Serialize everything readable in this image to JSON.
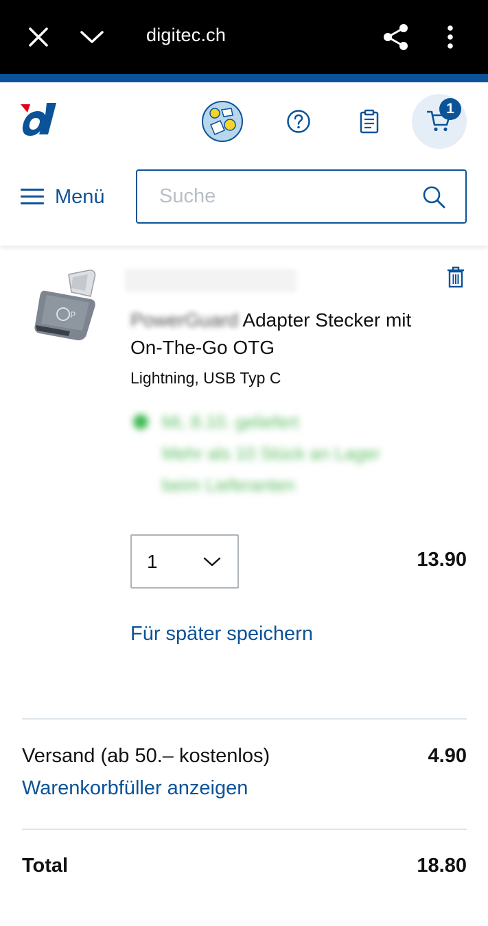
{
  "browser": {
    "url": "digitec.ch",
    "icons": [
      "close-icon",
      "chevron-down-icon",
      "share-icon",
      "more-vert-icon"
    ]
  },
  "header": {
    "logo": "digitec-logo",
    "cart_count": "1",
    "menu_label": "Menü",
    "search_placeholder": "Suche",
    "icons": [
      "promo-icon",
      "help-icon",
      "clipboard-icon",
      "cart-icon",
      "search-icon"
    ]
  },
  "product": {
    "title_brand": "PowerGuard",
    "title_rest": "Adapter Stecker mit On-The-Go OTG",
    "variant": "Lightning, USB Typ C",
    "delivery": {
      "line1": "Mi, 8.10. geliefert",
      "line2": "Mehr als 10 Stück an Lager",
      "line3": "beim Lieferanten"
    },
    "quantity": "1",
    "price": "13.90",
    "save_later": "Für später speichern"
  },
  "summary": {
    "shipping_label": "Versand (ab 50.– kostenlos)",
    "shipping_price": "4.90",
    "filler_link": "Warenkorbfüller anzeigen",
    "total_label": "Total",
    "total_price": "18.80"
  },
  "colors": {
    "brand_blue": "#0b5398",
    "logo_red": "#e2001a",
    "delivery_green": "#3fb950"
  }
}
